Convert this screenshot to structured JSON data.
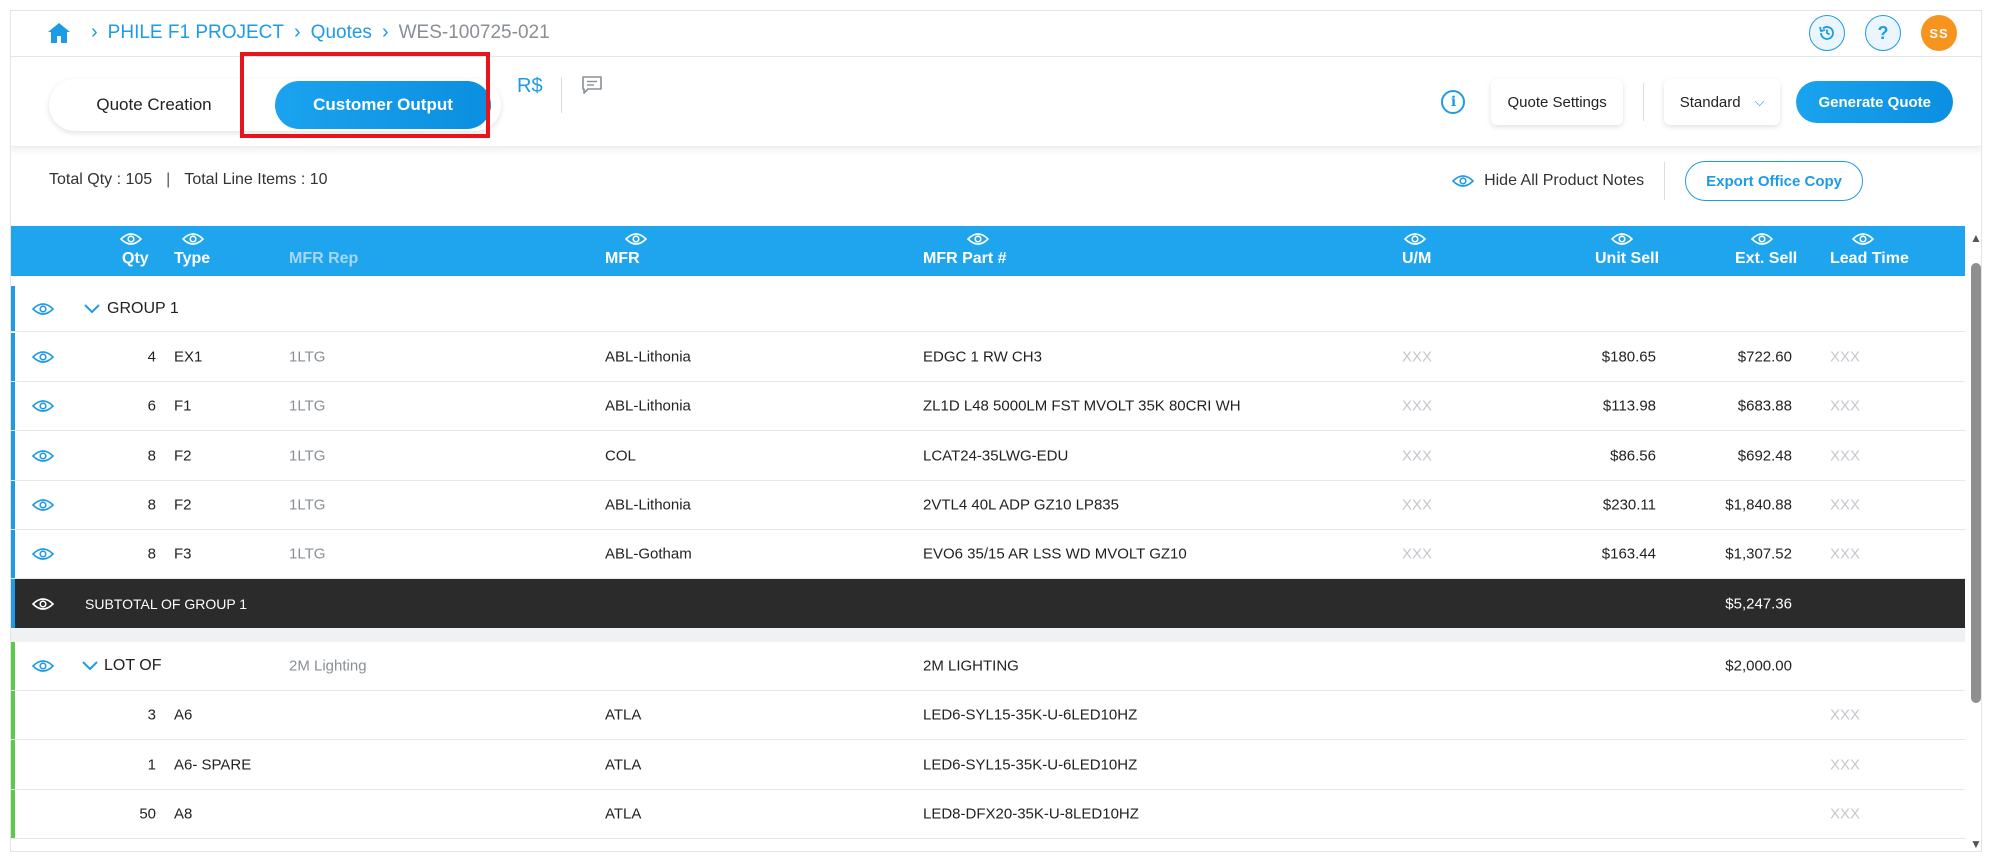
{
  "breadcrumb": {
    "items": [
      "PHILE F1 PROJECT",
      "Quotes"
    ],
    "current": "WES-100725-021"
  },
  "header": {
    "avatar_initials": "SS",
    "help_glyph": "?"
  },
  "toolbar": {
    "tab_quote_creation": "Quote Creation",
    "tab_customer_output": "Customer Output",
    "currency_glyph": "R$",
    "quote_settings": "Quote Settings",
    "template_select": "Standard",
    "generate_quote": "Generate Quote"
  },
  "summary": {
    "total_qty": "Total Qty : 105",
    "total_line_items": "Total Line Items : 10",
    "hide_notes": "Hide All Product Notes",
    "export_office_copy": "Export Office Copy"
  },
  "table": {
    "columns": {
      "qty": "Qty",
      "type": "Type",
      "mfr_rep": "MFR Rep",
      "mfr": "MFR",
      "part": "MFR Part #",
      "um": "U/M",
      "unit_sell": "Unit Sell",
      "ext_sell": "Ext. Sell",
      "lead_time": "Lead Time"
    },
    "group1": {
      "label": "GROUP 1",
      "rows": [
        {
          "qty": "4",
          "type": "EX1",
          "rep": "1LTG",
          "mfr": "ABL-Lithonia",
          "part": "EDGC 1 RW CH3",
          "um": "XXX",
          "unit": "$180.65",
          "ext": "$722.60",
          "lead": "XXX"
        },
        {
          "qty": "6",
          "type": "F1",
          "rep": "1LTG",
          "mfr": "ABL-Lithonia",
          "part": "ZL1D L48 5000LM FST MVOLT 35K 80CRI WH",
          "um": "XXX",
          "unit": "$113.98",
          "ext": "$683.88",
          "lead": "XXX"
        },
        {
          "qty": "8",
          "type": "F2",
          "rep": "1LTG",
          "mfr": "COL",
          "part": "LCAT24-35LWG-EDU",
          "um": "XXX",
          "unit": "$86.56",
          "ext": "$692.48",
          "lead": "XXX"
        },
        {
          "qty": "8",
          "type": "F2",
          "rep": "1LTG",
          "mfr": "ABL-Lithonia",
          "part": "2VTL4 40L ADP GZ10 LP835",
          "um": "XXX",
          "unit": "$230.11",
          "ext": "$1,840.88",
          "lead": "XXX"
        },
        {
          "qty": "8",
          "type": "F3",
          "rep": "1LTG",
          "mfr": "ABL-Gotham",
          "part": "EVO6 35/15 AR LSS WD MVOLT GZ10",
          "um": "XXX",
          "unit": "$163.44",
          "ext": "$1,307.52",
          "lead": "XXX"
        }
      ],
      "subtotal_label": "SUBTOTAL OF GROUP 1",
      "subtotal_value": "$5,247.36"
    },
    "lot": {
      "label": "LOT OF",
      "rep": "2M Lighting",
      "part": "2M LIGHTING",
      "ext": "$2,000.00",
      "rows": [
        {
          "qty": "3",
          "type": "A6",
          "mfr": "ATLA",
          "part": "LED6-SYL15-35K-U-6LED10HZ",
          "lead": "XXX"
        },
        {
          "qty": "1",
          "type": "A6- SPARE",
          "mfr": "ATLA",
          "part": "LED6-SYL15-35K-U-6LED10HZ",
          "lead": "XXX"
        },
        {
          "qty": "50",
          "type": "A8",
          "mfr": "ATLA",
          "part": "LED8-DFX20-35K-U-8LED10HZ",
          "lead": "XXX"
        }
      ]
    }
  },
  "colors": {
    "accent": "#1fa4ee",
    "highlight": "#e8141c",
    "group1_bar": "#1e9be6",
    "lot_bar": "#5cc94a",
    "subtotal_bg": "#2b2b2b",
    "avatar": "#f7941d"
  }
}
